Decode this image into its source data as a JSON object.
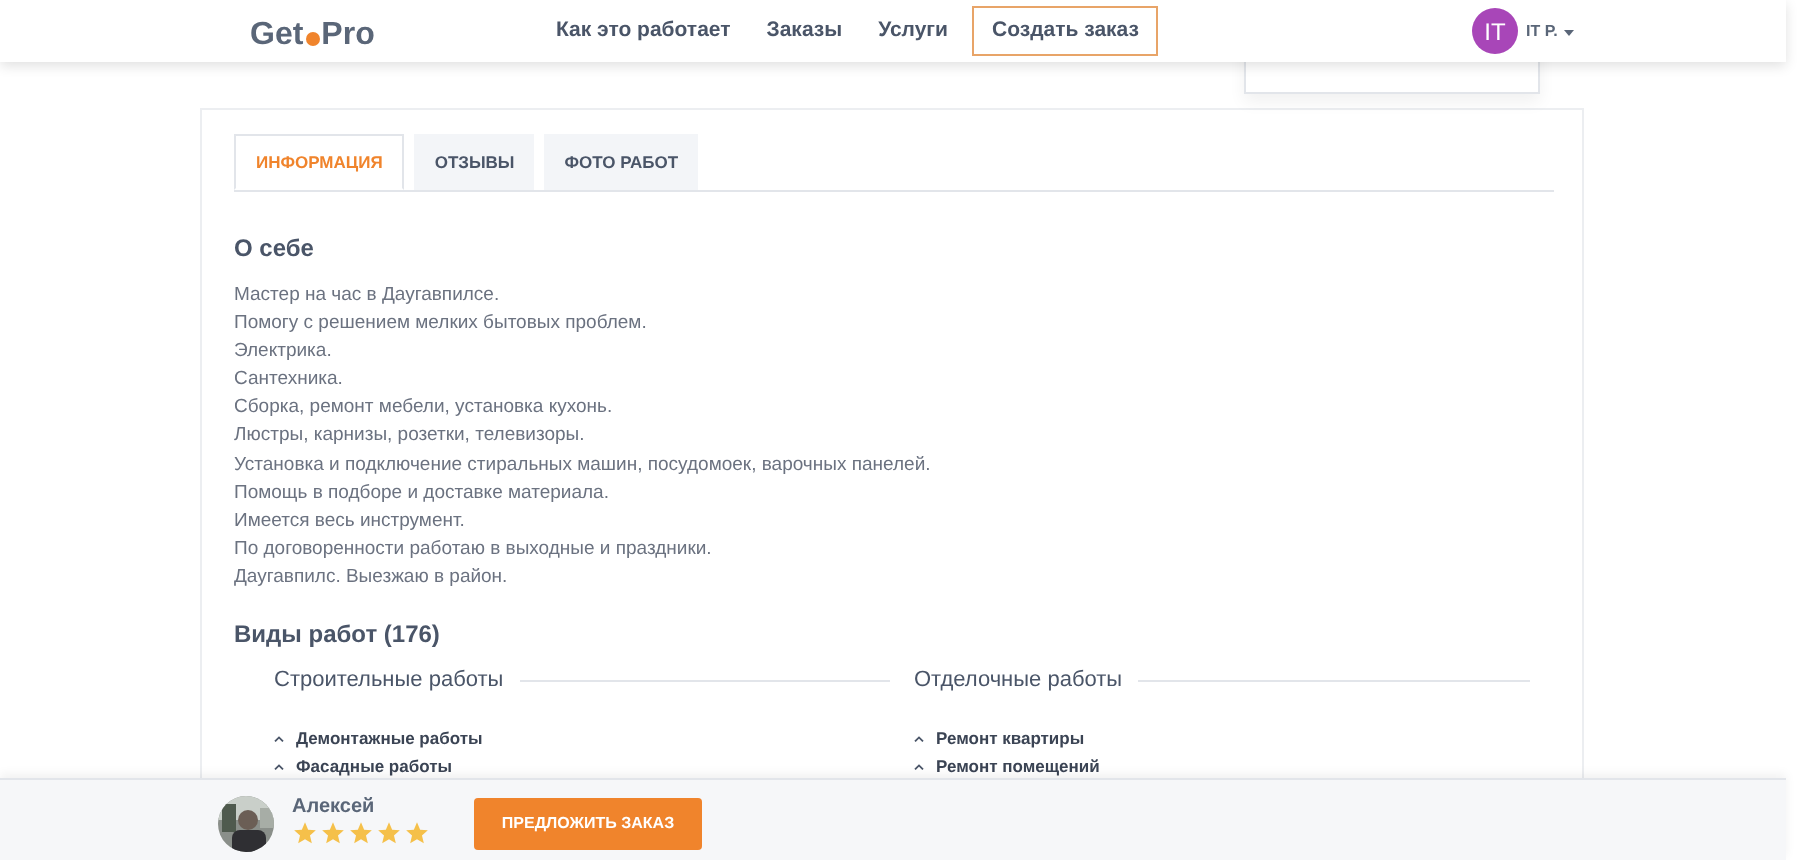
{
  "header": {
    "logo_left": "Get",
    "logo_right": "Pro",
    "nav": [
      {
        "label": "Как это работает",
        "kind": "link"
      },
      {
        "label": "Заказы",
        "kind": "link"
      },
      {
        "label": "Услуги",
        "kind": "link"
      },
      {
        "label": "Создать заказ",
        "kind": "outlined"
      }
    ],
    "user": {
      "initials": "IT",
      "name": "IT P."
    }
  },
  "tabs": [
    {
      "label": "ИНФОРМАЦИЯ",
      "selected": true
    },
    {
      "label": "ОТЗЫВЫ",
      "selected": false
    },
    {
      "label": "ФОТО РАБОТ",
      "selected": false
    }
  ],
  "about": {
    "title": "О себе",
    "lines": [
      "Мастер на час в Даугавпилсе.",
      "Помогу с решением мелких бытовых проблем.",
      "Электрика.",
      "Сантехника.",
      "Сборка, ремонт мебели, установка кухонь.",
      "Люстры, карнизы, розетки, телевизоры.",
      "Установка и подключение стиральных машин, посудомоек, варочных панелей.",
      "Помощь в подборе и доставке материала.",
      "Имеется весь инструмент.",
      "По договоренности работаю в выходные и праздники.",
      "Даугавпилс. Выезжаю в район."
    ]
  },
  "work_types": {
    "title": "Виды работ (176)",
    "groups": [
      {
        "title": "Строительные работы",
        "items": [
          "Демонтажные работы",
          "Фасадные работы"
        ]
      },
      {
        "title": "Отделочные работы",
        "items": [
          "Ремонт квартиры",
          "Ремонт помещений"
        ]
      }
    ]
  },
  "bottom_bar": {
    "name": "Алексей",
    "stars": 5,
    "button": "ПРЕДЛОЖИТЬ ЗАКАЗ"
  }
}
